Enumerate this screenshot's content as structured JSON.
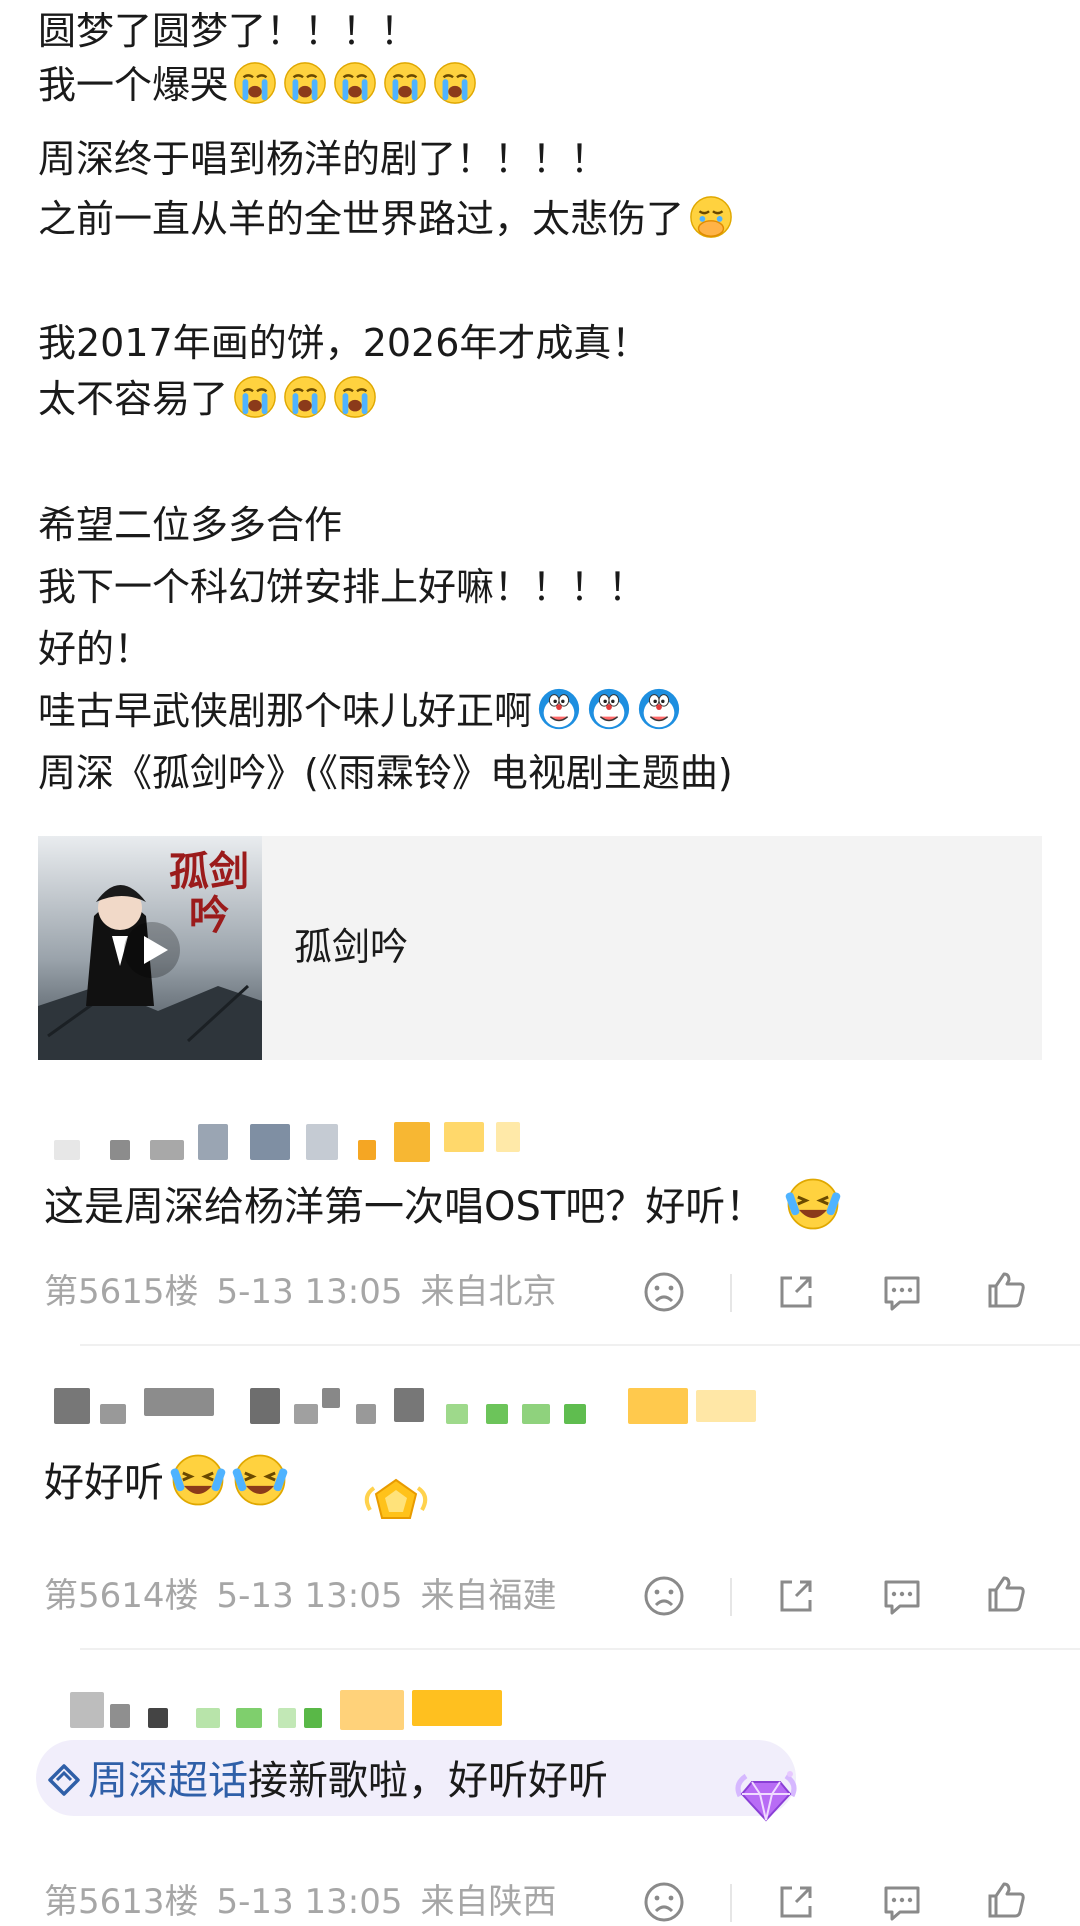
{
  "post": {
    "lines": [
      "圆梦了圆梦了！！！！",
      "我一个爆哭",
      "周深终于唱到杨洋的剧了！！！！",
      "之前一直从羊的全世界路过，太悲伤了",
      "我2017年画的饼，2026年才成真！",
      "太不容易了",
      "希望二位多多合作",
      "我下一个科幻饼安排上好嘛！！！！",
      "好的！",
      "哇古早武侠剧那个味儿好正啊",
      "周深《孤剑吟》(《雨霖铃》电视剧主题曲)"
    ]
  },
  "music": {
    "title": "孤剑吟",
    "cover_title": "孤剑吟",
    "cover_icon": "play-icon"
  },
  "comments": [
    {
      "text": "这是周深给杨洋第一次唱OST吧？好听！",
      "floor": "第5615楼",
      "date": "5-13 13:05",
      "location": "来自北京"
    },
    {
      "text": "好好听",
      "floor": "第5614楼",
      "date": "5-13 13:05",
      "location": "来自福建"
    },
    {
      "topic_link": "周深超话",
      "text": "接新歌啦，好听好听",
      "floor": "第5613楼",
      "date": "5-13 13:05",
      "location": "来自陕西"
    }
  ],
  "icons": {
    "dislike": "frown-icon",
    "share": "share-icon",
    "comment": "comment-icon",
    "like": "thumbs-up-icon"
  },
  "colors": {
    "text": "#1a1a1a",
    "meta": "#a6a6a6",
    "topic_link": "#2f5fa8",
    "topic_bg": "#f1eefb",
    "card_bg": "#f3f3f3"
  }
}
